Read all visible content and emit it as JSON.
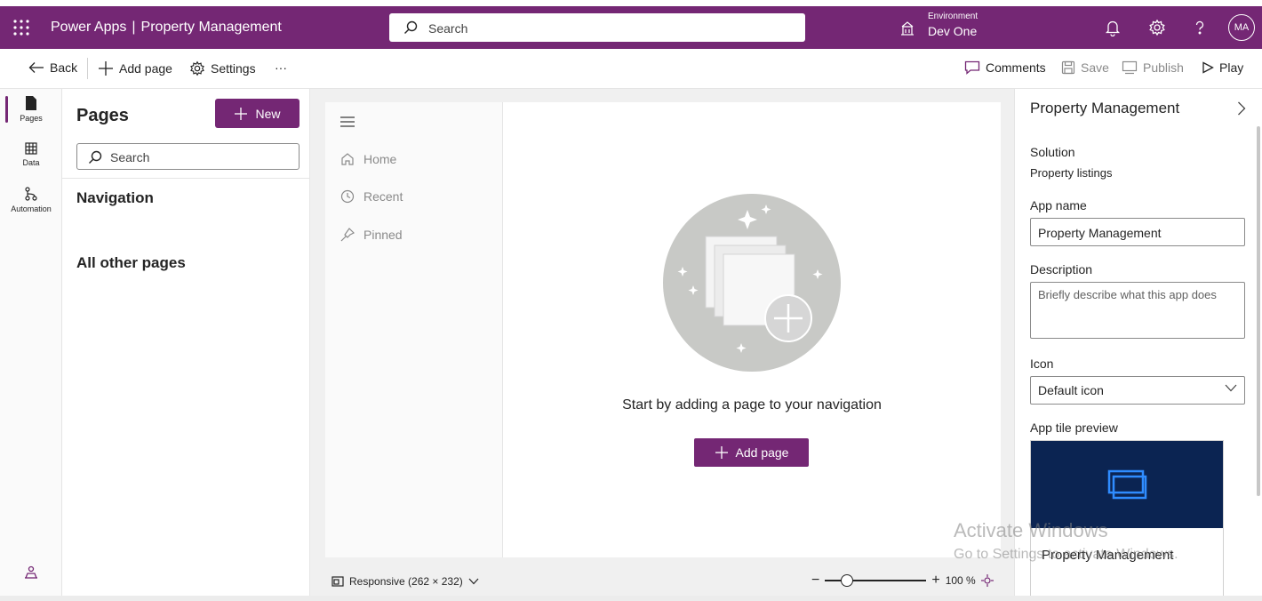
{
  "header": {
    "app_name": "Power Apps",
    "separator": "|",
    "project_name": "Property Management",
    "search_placeholder": "Search",
    "environment_label": "Environment",
    "environment_name": "Dev One",
    "avatar_initials": "MA"
  },
  "commandbar": {
    "back": "Back",
    "add_page": "Add page",
    "settings": "Settings",
    "more": "···",
    "comments": "Comments",
    "save": "Save",
    "publish": "Publish",
    "play": "Play"
  },
  "rail": {
    "items": [
      {
        "label": "Pages",
        "icon": "page-icon"
      },
      {
        "label": "Data",
        "icon": "table-icon"
      },
      {
        "label": "Automation",
        "icon": "flow-icon"
      }
    ]
  },
  "pages_panel": {
    "title": "Pages",
    "new_button": "New",
    "search_placeholder": "Search",
    "navigation_heading": "Navigation",
    "other_heading": "All other pages"
  },
  "preview": {
    "nav_items": [
      {
        "label": "Home",
        "icon": "home-icon"
      },
      {
        "label": "Recent",
        "icon": "clock-icon"
      },
      {
        "label": "Pinned",
        "icon": "pin-icon"
      }
    ],
    "empty_message": "Start by adding a page to your navigation",
    "add_page_button": "Add page"
  },
  "statusbar": {
    "layout": "Responsive (262 × 232)",
    "zoom_minus": "−",
    "zoom_plus": "+",
    "zoom_level": "100 %"
  },
  "properties": {
    "title": "Property Management",
    "solution_label": "Solution",
    "solution_value": "Property listings",
    "app_name_label": "App name",
    "app_name_value": "Property Management",
    "description_label": "Description",
    "description_placeholder": "Briefly describe what this app does",
    "icon_label": "Icon",
    "icon_value": "Default icon",
    "tile_label": "App tile preview",
    "tile_name": "Property Management"
  },
  "watermark": {
    "line1": "Activate Windows",
    "line2": "Go to Settings to activate Windows."
  },
  "colors": {
    "brand": "#742774",
    "tile": "#0b2452",
    "tile_icon": "#2f8cff"
  }
}
